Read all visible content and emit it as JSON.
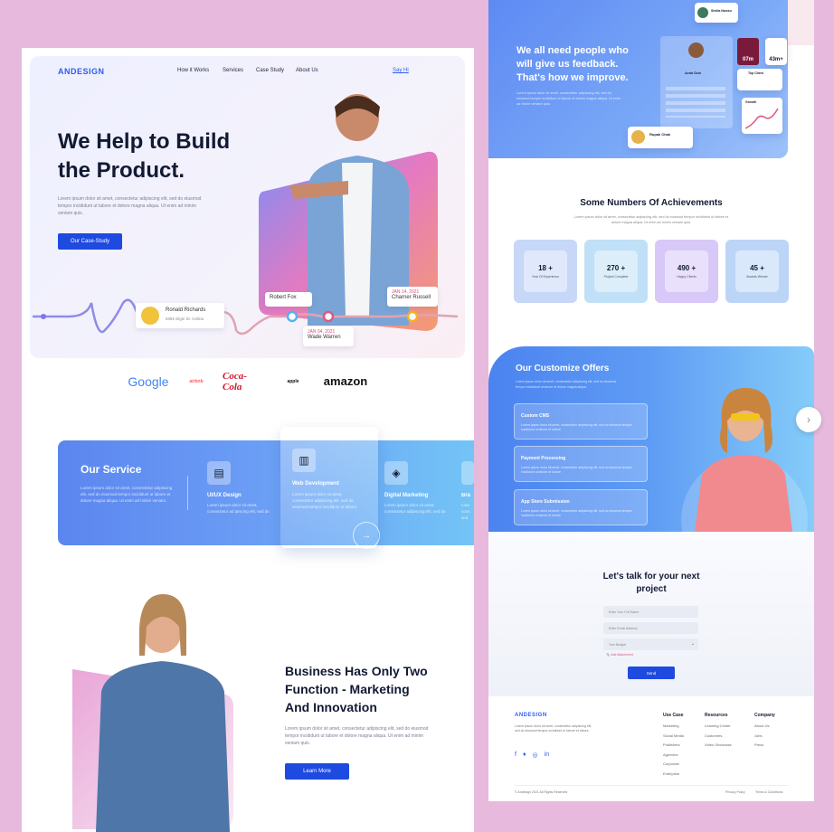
{
  "left": {
    "logo": "ANDESIGN",
    "nav": [
      "How it Works",
      "Services",
      "Case Study",
      "About Us"
    ],
    "say_hi": "Say Hi",
    "hero_title_1": "We Help to Build",
    "hero_title_2": "the Product.",
    "hero_lorem": "Lorem ipsum dolor sit amet, consectetur adipiscing elit, sed do eiusmod tempor incididunt ut labore et dolore magna aliqua. Ut enim ad minim veniam quis.",
    "hero_button": "Our Case-Study",
    "people": [
      {
        "name": "Ronald Richards",
        "address": "6391 Elgin St. Celina"
      },
      {
        "name": "Robert Fox"
      },
      {
        "date": "JAN 14, 2021",
        "name": "Charner Russell"
      },
      {
        "date": "JAN 04, 2021",
        "name": "Wade Warren"
      }
    ],
    "brands": [
      "Google",
      "airbnb",
      "Coca-Cola",
      "apple",
      "amazon"
    ],
    "service_title": "Our Service",
    "service_lorem": "Lorem ipsum dolor sit amet, consectetur adipiscing elit, sed do eiusmod tempor incididunt ut labore et dolore magna aliqua. Ut enim ad minim veniam.",
    "services": [
      {
        "label": "UI/UX Design",
        "text": "Lorem ipsum dolor sit amet, consectetur ad ipiscing elit, sed do"
      },
      {
        "label": "Web Development",
        "text": "Lorem ipsum dolor sit amet, consectetur adipiscing elit, sed do eiusmod tempor incididunt ut labore"
      },
      {
        "label": "Digital Marketing",
        "text": "Lorem ipsum dolor sit amet, consectetur adipiscing elit, sed do"
      },
      {
        "label": "Bra",
        "text": "Lore cons sed"
      }
    ],
    "business_title_1": "Business Has Only Two",
    "business_title_2": "Function - Marketing",
    "business_title_3": "And Innovation",
    "business_lorem": "Lorem ipsum dolor sit amet, consectetur adipiscing elit, sed do eiusmod tempor incididunt ut labore et dolore magna aliqua. Ut enim ad minim veniam quis.",
    "business_button": "Learn More"
  },
  "right": {
    "feedback_title_1": "We all need people who",
    "feedback_title_2": "will give us feedback.",
    "feedback_title_3": "That's how we improve.",
    "feedback_lorem": "Lorem ipsum dolor sit amet, consectetur adipiscing elit, sed do eiusmod tempor incididunt ut labore et dolore magna aliqua. Ut enim ad minim veniam quis.",
    "profile": {
      "name": "Arab Dob",
      "top_name": "Sheila Nwosu",
      "bottom_name": "Rupak Chak",
      "client_label": "Top Client",
      "growth_label": "Growth",
      "metric_1": "07m",
      "metric_2": "43m+"
    },
    "achievements_title": "Some Numbers Of Achievements",
    "achievements_lorem": "Lorem ipsum dolor sit amet, consectetur adipiscing elit, sed do eiusmod tempor incididunt ut labore et dolore magna aliqua. Ut enim ad minim veniam quis.",
    "stats": [
      {
        "value": "18 +",
        "label": "Year Of Experience",
        "bg": "#c7d7f7"
      },
      {
        "value": "270 +",
        "label": "Project Complete",
        "bg": "#bfe0f6"
      },
      {
        "value": "490 +",
        "label": "Happy Clients",
        "bg": "#d8c8f7"
      },
      {
        "value": "45 +",
        "label": "Awards Winner",
        "bg": "#bcd5f7"
      }
    ],
    "offers_title": "Our Customize Offers",
    "offers_lorem": "Lorem ipsum dolor sit amet, consectetur adipiscing elit, sed do eiusmod tempor incididunt ut labore et dolore magna aliqua.",
    "offers": [
      {
        "title": "Custom CMS",
        "text": "Lorem ipsum dolor sit amet, consectetur adipiscing elit, sed do eiusmod tempor incididunt ut labore et dolore"
      },
      {
        "title": "Payment Processing",
        "text": "Lorem ipsum dolor sit amet, consectetur adipiscing elit, sed do eiusmod tempor incididunt ut labore et dolore"
      },
      {
        "title": "App Store Submission",
        "text": "Lorem ipsum dolor sit amet, consectetur adipiscing elit, sed do eiusmod tempor incididunt ut labore et dolore"
      }
    ],
    "contact_title_1": "Let's talk for your next",
    "contact_title_2": "project",
    "contact_fields": [
      "Enter Your Full Name",
      "Enter Email Address",
      "Your Budget"
    ],
    "add_attachment": "Add Attachment",
    "send": "Send",
    "footer": {
      "logo": "ANDESIGN",
      "lorem": "Lorem ipsum dolor sit amet, consectetur adipiscing elit, sed do eiusmod tempor incididunt ut labore et dolore.",
      "use_case_title": "Use Case",
      "use_case": [
        "Marketing",
        "Social Media",
        "Publishers",
        "Agencies",
        "Corporate",
        "Enterprise"
      ],
      "resources_title": "Resources",
      "resources": [
        "Learning Center",
        "Customers",
        "Video Showcase"
      ],
      "company_title": "Company",
      "company": [
        "About Us",
        "Jobs",
        "Press"
      ],
      "copyright": "© Andesign 2021 All Rights Reserved",
      "privacy": "Privacy Policy",
      "terms": "Terms & Conditions"
    }
  }
}
